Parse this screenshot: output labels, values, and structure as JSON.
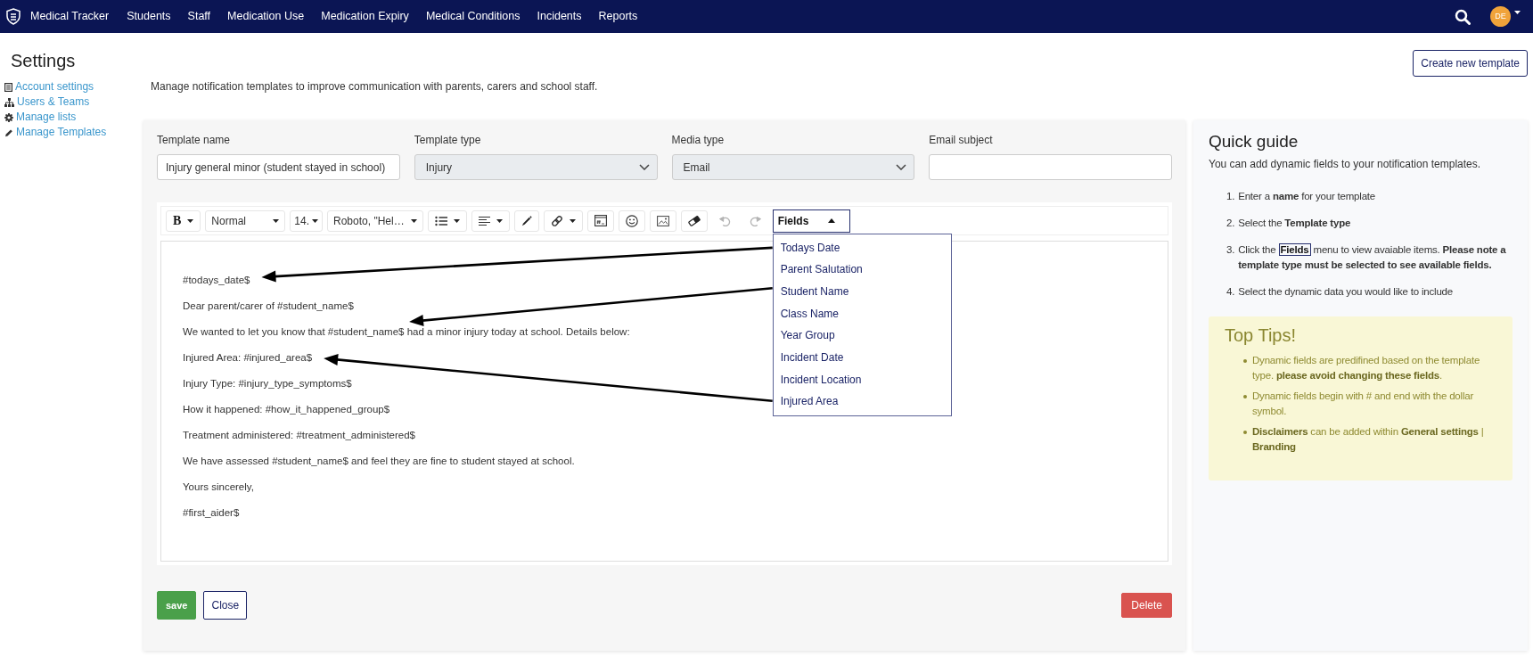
{
  "navbar": {
    "brand": "Medical Tracker",
    "links": [
      "Students",
      "Staff",
      "Medication Use",
      "Medication Expiry",
      "Medical Conditions",
      "Incidents",
      "Reports"
    ],
    "avatar": "DE"
  },
  "sidebar": {
    "title": "Settings",
    "items": [
      "Account settings",
      "Users & Teams",
      "Manage lists",
      "Manage Templates"
    ]
  },
  "page": {
    "description": "Manage notification templates to improve communication with parents, carers and school staff.",
    "create_button": "Create new template"
  },
  "form": {
    "fields": [
      {
        "kind": "text",
        "label": "Template name",
        "value": "Injury general minor (student stayed in school)",
        "disabled": false
      },
      {
        "kind": "select",
        "label": "Template type",
        "value": "Injury",
        "disabled": true
      },
      {
        "kind": "select",
        "label": "Media type",
        "value": "Email",
        "disabled": true
      },
      {
        "kind": "text",
        "label": "Email subject",
        "disabled": false
      }
    ]
  },
  "toolbar": {
    "bold": "B",
    "style": "Normal",
    "size": "14.",
    "font": "Roboto, \"Hel…",
    "undo": {
      "disabled": true
    },
    "redo": {
      "disabled": true
    }
  },
  "fields_menu": {
    "label": "Fields",
    "expanded": true,
    "items": [
      "Todays Date",
      "Parent Salutation",
      "Student Name",
      "Class Name",
      "Year Group",
      "Incident Date",
      "Incident Location",
      "Injured Area"
    ]
  },
  "editor": {
    "blocks": [
      {
        "lines": [
          "#todays_date$",
          "Dear parent/carer of #student_name$",
          "We wanted to let you know that #student_name$ had a minor injury today at school. Details below:",
          "Injured Area: #injured_area$",
          "Injury Type: #injury_type_symptoms$",
          "How it happened: #how_it_happened_group$",
          "Treatment administered: #treatment_administered$",
          "We have assessed #student_name$ and feel they are fine to student stayed at school."
        ]
      },
      {
        "lines": [
          "Yours sincerely,"
        ]
      },
      {
        "lines": [
          "#first_aider$"
        ]
      }
    ]
  },
  "actions": {
    "save": "save",
    "close": "Close",
    "delete": "Delete"
  },
  "guide": {
    "title": "Quick guide",
    "intro": "You can add dynamic fields to your notification templates.",
    "steps": [
      {
        "number": "1.",
        "text": "Enter a **name** for your template"
      },
      {
        "number": "2.",
        "text": "Select the **Template type**"
      },
      {
        "number": "3.",
        "text": "Click the",
        "boxed": "Fields",
        "after": "menu to view avaiable items. **Please note a template type must be selected to see available fields.**"
      },
      {
        "number": "4.",
        "text": "Select the dynamic data you would like to include"
      }
    ],
    "tips": {
      "title": "Top Tips!",
      "items": [
        "Dynamic fields are predifined based on the template type. **please avoid changing these fields**.",
        "Dynamic fields begin with # and end with the dollar symbol.",
        "**Disclaimers** can be added within **General settings** | **Branding**"
      ]
    }
  }
}
